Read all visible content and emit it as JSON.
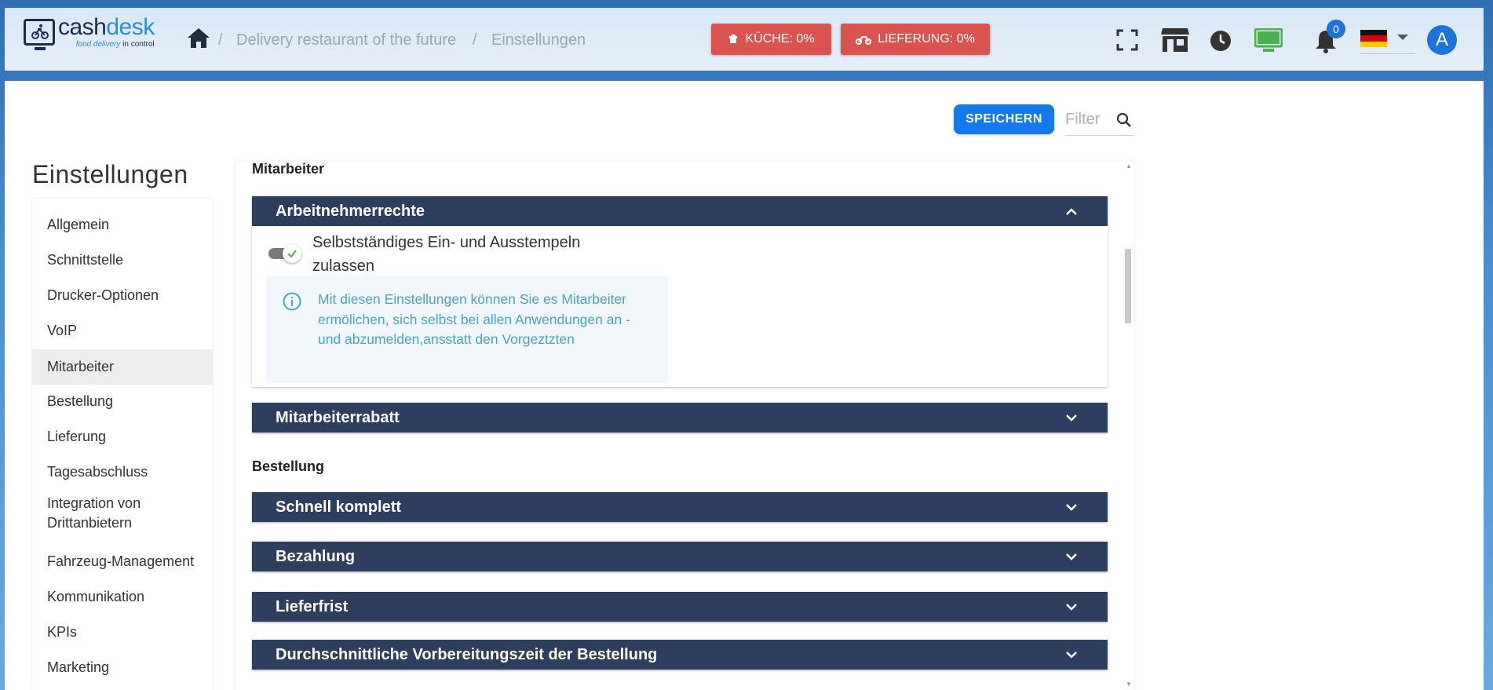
{
  "header": {
    "logo": {
      "text_a": "cash",
      "text_b": "desk",
      "tagline_a": "food delivery",
      "tagline_b": "in control"
    },
    "breadcrumb": [
      {
        "label": "Delivery restaurant of the future"
      },
      {
        "label": "Einstellungen"
      }
    ],
    "breadcrumb_separator": "/",
    "kitchen_status": "KÜCHE: 0%",
    "delivery_status": "LIEFERUNG: 0%",
    "notification_count": "0",
    "avatar_letter": "A",
    "status_color": "#d9534f",
    "accent_color": "#1e73d9"
  },
  "toolbar": {
    "save_label": "SPEICHERN",
    "filter_placeholder": "Filter"
  },
  "sidebar": {
    "title": "Einstellungen",
    "items": [
      {
        "label": "Allgemein"
      },
      {
        "label": "Schnittstelle"
      },
      {
        "label": "Drucker-Optionen"
      },
      {
        "label": "VoIP"
      },
      {
        "label": "Mitarbeiter",
        "active": true
      },
      {
        "label": "Bestellung"
      },
      {
        "label": "Lieferung"
      },
      {
        "label": "Tagesabschluss"
      },
      {
        "label": "Integration von Drittanbietern"
      },
      {
        "label": "Fahrzeug-Management"
      },
      {
        "label": "Kommunikation"
      },
      {
        "label": "KPIs"
      },
      {
        "label": "Marketing"
      }
    ]
  },
  "content": {
    "section_mitarbeiter": "Mitarbeiter",
    "section_bestellung": "Bestellung",
    "panels": [
      {
        "title": "Arbeitnehmerrechte",
        "expanded": true
      },
      {
        "title": "Mitarbeiterrabatt",
        "expanded": false
      },
      {
        "title": "Schnell komplett",
        "expanded": false
      },
      {
        "title": "Bezahlung",
        "expanded": false
      },
      {
        "title": "Lieferfrist",
        "expanded": false
      },
      {
        "title": "Durchschnittliche Vorbereitungszeit der Bestellung",
        "expanded": false
      }
    ],
    "toggle_label": "Selbstständiges Ein- und Ausstempeln zulassen",
    "toggle_on": true,
    "info_text": "Mit diesen Einstellungen können Sie es Mitarbeiter ermölichen, sich selbst bei allen Anwendungen an -und abzumelden,ansstatt den Vorgeztzten",
    "panel_color": "#2d3e5e"
  }
}
